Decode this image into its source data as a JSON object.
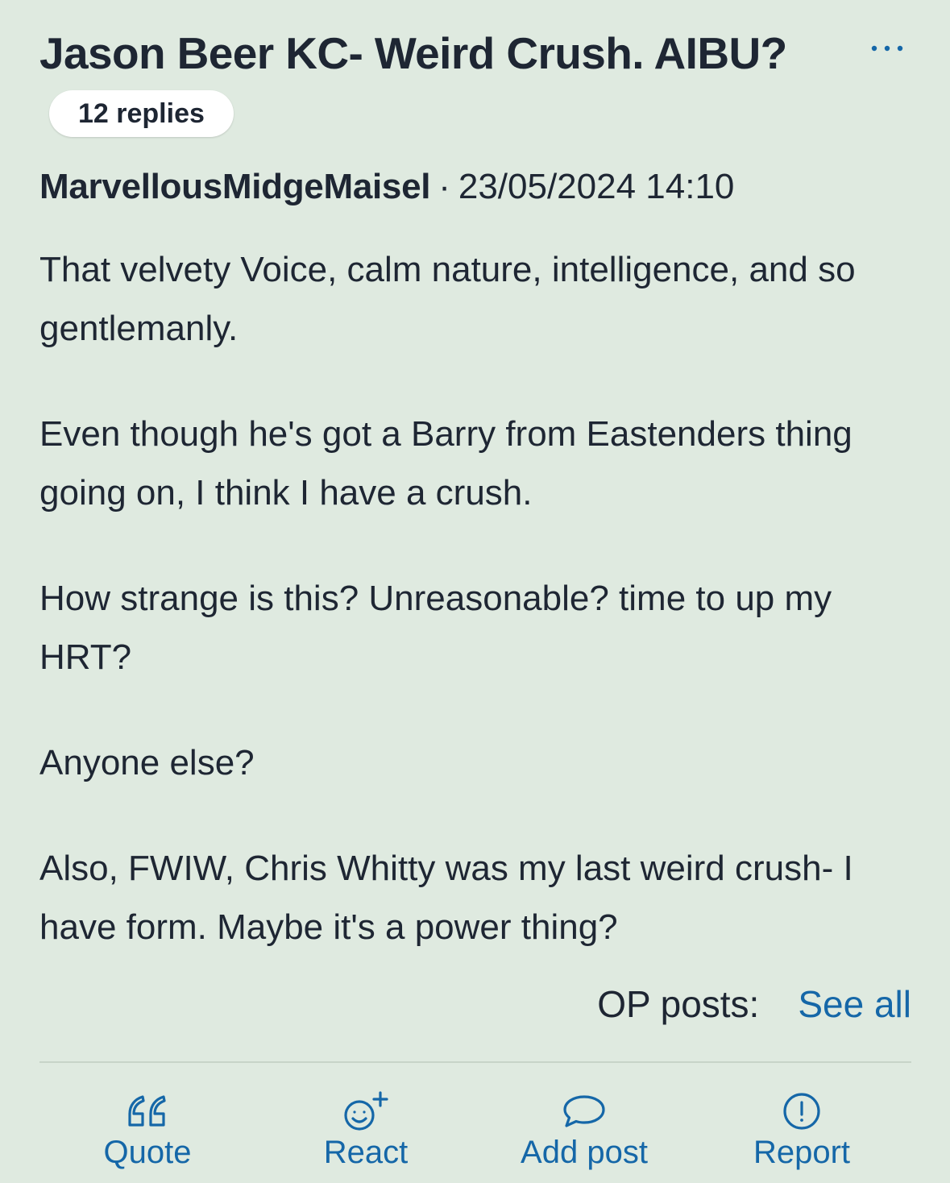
{
  "thread": {
    "title": "Jason Beer KC- Weird Crush. AIBU?",
    "replies": "12 replies",
    "more_icon": "ellipsis-icon"
  },
  "post": {
    "author": "MarvellousMidgeMaisel",
    "separator": "·",
    "date": "23/05/2024 14:10",
    "paragraphs": [
      "That velvety Voice, calm nature, intelligence, and so gentlemanly.",
      "Even though he's got a Barry from Eastenders thing going on, I think I have a crush.",
      "How strange is this? Unreasonable? time to up my HRT?",
      "Anyone else?",
      "Also, FWIW, Chris Whitty was my last weird crush- I have form. Maybe it's a power thing?"
    ],
    "op_posts_label": "OP posts:",
    "see_all_label": "See all"
  },
  "actions": [
    {
      "label": "Quote",
      "icon": "quote-icon"
    },
    {
      "label": "React",
      "icon": "smiley-plus-icon"
    },
    {
      "label": "Add post",
      "icon": "speech-bubble-icon"
    },
    {
      "label": "Report",
      "icon": "exclamation-circle-icon"
    }
  ],
  "colors": {
    "background": "#dfeae0",
    "text": "#1e2633",
    "accent": "#1567a8",
    "pill": "#ffffff"
  }
}
